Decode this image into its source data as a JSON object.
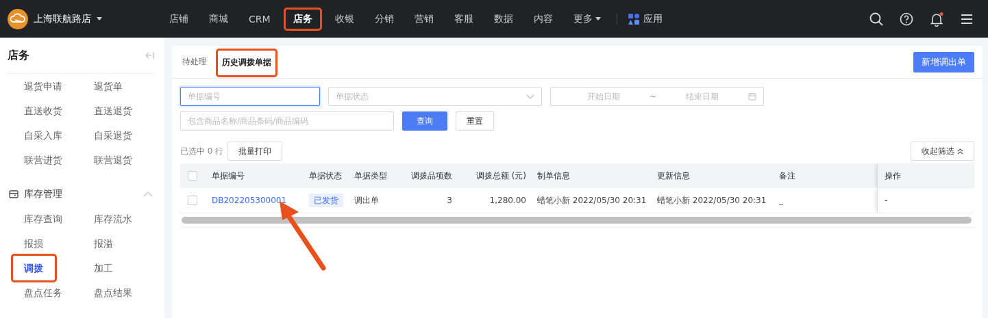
{
  "brand": {
    "name": "上海联航路店"
  },
  "nav": [
    {
      "label": "店铺",
      "kind": "link",
      "selected": false,
      "highlighted": false
    },
    {
      "label": "商城",
      "kind": "link",
      "selected": false,
      "highlighted": false
    },
    {
      "label": "CRM",
      "kind": "link",
      "selected": false,
      "highlighted": false
    },
    {
      "label": "店务",
      "kind": "link",
      "selected": true,
      "highlighted": true
    },
    {
      "label": "收银",
      "kind": "link",
      "selected": false,
      "highlighted": false
    },
    {
      "label": "分销",
      "kind": "link",
      "selected": false,
      "highlighted": false
    },
    {
      "label": "营销",
      "kind": "link",
      "selected": false,
      "highlighted": false
    },
    {
      "label": "客服",
      "kind": "link",
      "selected": false,
      "highlighted": false
    },
    {
      "label": "数据",
      "kind": "link",
      "selected": false,
      "highlighted": false
    },
    {
      "label": "内容",
      "kind": "link",
      "selected": false,
      "highlighted": false
    },
    {
      "label": "更多",
      "kind": "dropdown",
      "selected": false,
      "highlighted": false
    }
  ],
  "apps": {
    "label": "应用"
  },
  "notifications": {
    "unread": true
  },
  "sidebar": {
    "title": "店务",
    "groups": [
      {
        "items": [
          {
            "label": "退货申请",
            "selected": false,
            "highlighted": false
          },
          {
            "label": "退货单",
            "selected": false,
            "highlighted": false
          },
          {
            "label": "直送收货",
            "selected": false,
            "highlighted": false
          },
          {
            "label": "直送退货",
            "selected": false,
            "highlighted": false
          },
          {
            "label": "自采入库",
            "selected": false,
            "highlighted": false
          },
          {
            "label": "自采退货",
            "selected": false,
            "highlighted": false
          },
          {
            "label": "联营进货",
            "selected": false,
            "highlighted": false
          },
          {
            "label": "联营退货",
            "selected": false,
            "highlighted": false
          }
        ]
      },
      {
        "title": "库存管理",
        "expanded": true,
        "items": [
          {
            "label": "库存查询",
            "selected": false,
            "highlighted": false
          },
          {
            "label": "库存流水",
            "selected": false,
            "highlighted": false
          },
          {
            "label": "报损",
            "selected": false,
            "highlighted": false
          },
          {
            "label": "报溢",
            "selected": false,
            "highlighted": false
          },
          {
            "label": "调拨",
            "selected": true,
            "highlighted": true
          },
          {
            "label": "加工",
            "selected": false,
            "highlighted": false
          },
          {
            "label": "盘点任务",
            "selected": false,
            "highlighted": false
          },
          {
            "label": "盘点结果",
            "selected": false,
            "highlighted": false
          }
        ]
      }
    ]
  },
  "tabs": [
    {
      "label": "待处理",
      "selected": false,
      "highlighted": false
    },
    {
      "label": "历史调拨单据",
      "selected": true,
      "highlighted": true
    }
  ],
  "new_button": "新增调出单",
  "filters": {
    "doc_no": {
      "placeholder": "单据编号"
    },
    "status": {
      "placeholder": "单据状态"
    },
    "date_range": {
      "start_placeholder": "开始日期",
      "separator": "~",
      "end_placeholder": "结束日期"
    },
    "keyword": {
      "placeholder": "包含商品名称/商品条码/商品编码"
    },
    "query_button": "查询",
    "reset_button": "重置"
  },
  "selection": {
    "text": "已选中 0 行"
  },
  "batch_print_button": "批量打印",
  "collapse_filters_button": "收起筛选",
  "table": {
    "header_checked": false,
    "columns": [
      "单据编号",
      "单据状态",
      "单据类型",
      "调拨品项数",
      "调拨总额 (元)",
      "制单信息",
      "更新信息",
      "备注",
      "操作"
    ],
    "rows": [
      {
        "checked": false,
        "doc_no": "DB202205300001",
        "status": "已发货",
        "type": "调出单",
        "item_count": "3",
        "amount": "1,280.00",
        "created": "蜡笔小新 2022/05/30 20:31",
        "updated": "蜡笔小新 2022/05/30 20:31",
        "remark": "_",
        "actions": "-"
      }
    ]
  }
}
